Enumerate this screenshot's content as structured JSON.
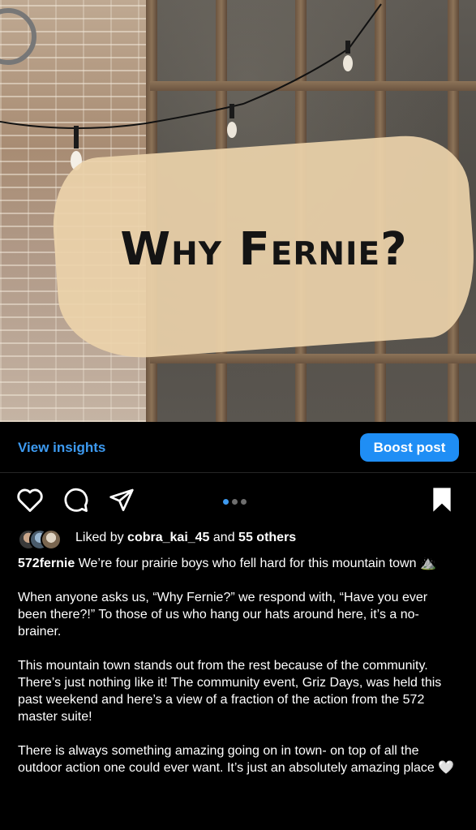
{
  "post_image": {
    "overlay_text": "Why Fernie?"
  },
  "insights_bar": {
    "view_insights_label": "View insights",
    "boost_label": "Boost post"
  },
  "actions": {
    "icons": [
      "heart-icon",
      "comment-icon",
      "share-icon",
      "bookmark-icon"
    ],
    "carousel": {
      "count": 3,
      "active": 1
    }
  },
  "likes": {
    "prefix": "Liked by ",
    "user": "cobra_kai_45",
    "middle": " and ",
    "others": "55 others"
  },
  "caption": {
    "username": "572fernie",
    "first_line": "We’re four prairie boys who fell hard for this mountain town ⛰️",
    "paragraph_2": "When anyone asks us, “Why Fernie?” we respond with, “Have you ever been there?!” To those of us who hang our hats around here, it’s a no-brainer.",
    "paragraph_3": "This mountain town stands out from the rest because of the community. There’s just nothing like it! The community event, Griz Days, was held this past weekend and here’s a view of a fraction of the action from the 572 master suite!",
    "paragraph_4": "There is always something amazing going on in town- on top of all the outdoor action one could ever want. It’s just an absolutely amazing place 🤍"
  },
  "colors": {
    "background": "#000000",
    "accent_blue": "#1f8ef5",
    "link_blue": "#3d9af0",
    "banner": "#ecd3aa"
  }
}
